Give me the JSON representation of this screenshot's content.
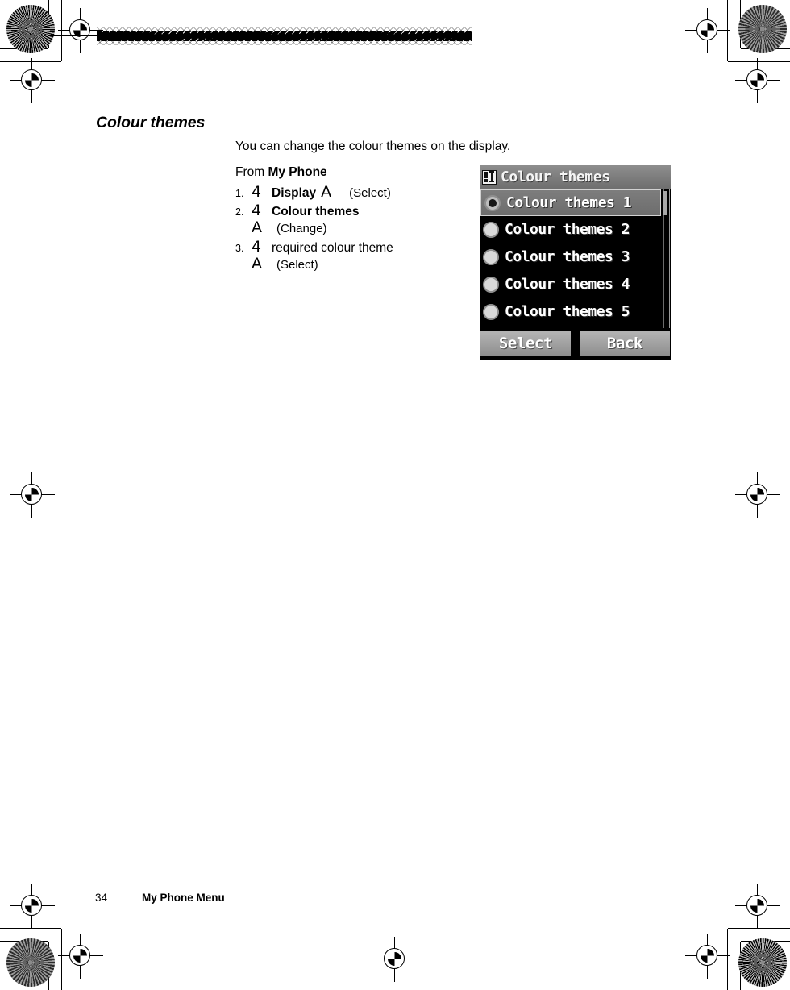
{
  "page": {
    "heading": "Colour themes",
    "intro": "You can change the colour themes on the display.",
    "from_prefix": "From ",
    "from_menu": "My Phone"
  },
  "steps": [
    {
      "number": "1.",
      "nav_glyph": "4",
      "label": "Display",
      "label_bold": true,
      "action_glyph": "A",
      "action_text": "(Select)",
      "sub": null
    },
    {
      "number": "2.",
      "nav_glyph": "4",
      "label": "Colour themes",
      "label_bold": true,
      "action_glyph": "A",
      "action_text": "(Change)",
      "sub": true
    },
    {
      "number": "3.",
      "nav_glyph": "4",
      "label": "required colour theme",
      "label_bold": false,
      "action_glyph": "A",
      "action_text": "(Select)",
      "sub": true
    }
  ],
  "phone_screen": {
    "title": "Colour themes",
    "title_icon": "display-settings-icon",
    "items": [
      {
        "label": "Colour themes 1",
        "selected": true
      },
      {
        "label": "Colour themes 2",
        "selected": false
      },
      {
        "label": "Colour themes 3",
        "selected": false
      },
      {
        "label": "Colour themes 4",
        "selected": false
      },
      {
        "label": "Colour themes 5",
        "selected": false
      }
    ],
    "softkey_left": "Select",
    "softkey_right": "Back",
    "colors": {
      "screen_bg": "#000000",
      "titlebar": "#7c7c7c",
      "highlight": "#6d6d6d",
      "text": "#ffffff",
      "softkey": "#9d9d9d"
    }
  },
  "footer": {
    "page_number": "34",
    "section": "My Phone Menu"
  }
}
